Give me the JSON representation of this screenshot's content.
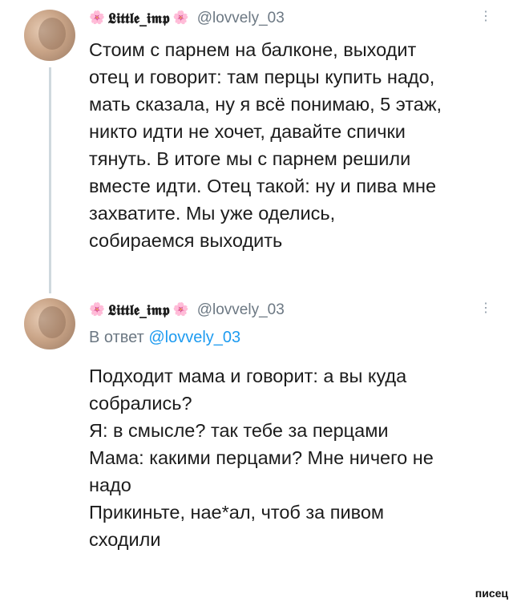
{
  "tweets": [
    {
      "display_name": "𝕷𝖎𝖙𝖙𝖑𝖊_𝖎𝖒𝖕",
      "handle": "@lovvely_03",
      "text_lines": [
        "Стоим с парнем на балконе, выходит",
        "отец и говорит: там перцы купить надо,",
        "мать сказала, ну я всё понимаю, 5 этаж,",
        "никто идти не хочет, давайте спички",
        "тянуть. В итоге мы с парнем решили",
        "вместе идти. Отец такой: ну и пива мне",
        "захватите. Мы уже оделись,",
        "собираемся выходить"
      ]
    },
    {
      "display_name": "𝕷𝖎𝖙𝖙𝖑𝖊_𝖎𝖒𝖕",
      "handle": "@lovvely_03",
      "reply_prefix": "В ответ",
      "reply_mention": "@lovvely_03",
      "text_lines": [
        "Подходит мама и говорит: а вы куда",
        "собрались?",
        "Я: в смысле? так тебе за перцами",
        "Мама: какими перцами? Мне ничего не",
        "надо",
        "Прикиньте, нае*ал, чтоб за пивом",
        "сходили"
      ]
    }
  ],
  "icons": {
    "flower": "🌸",
    "more": "⋮"
  },
  "watermark": "писец",
  "colors": {
    "link": "#1d9bf0",
    "secondary_text": "#6c7883",
    "flower": "#e58aa6"
  }
}
